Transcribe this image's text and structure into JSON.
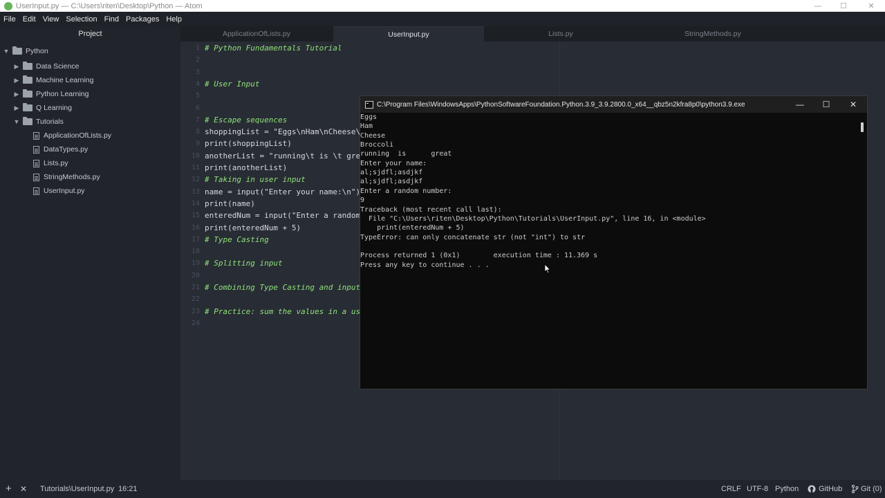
{
  "window": {
    "title": "UserInput.py — C:\\Users\\riten\\Desktop\\Python — Atom",
    "controls": [
      "—",
      "☐",
      "✕"
    ]
  },
  "menu": [
    "File",
    "Edit",
    "View",
    "Selection",
    "Find",
    "Packages",
    "Help"
  ],
  "sidebar": {
    "title": "Project",
    "root": "Python",
    "folders": [
      "Data Science",
      "Machine Learning",
      "Python Learning",
      "Q Learning",
      "Tutorials"
    ],
    "files": [
      "ApplicationOfLists.py",
      "DataTypes.py",
      "Lists.py",
      "StringMethods.py",
      "UserInput.py"
    ]
  },
  "tabs": [
    "ApplicationOfLists.py",
    "UserInput.py",
    "Lists.py",
    "StringMethods.py"
  ],
  "editor": {
    "line_numbers": [
      "1",
      "2",
      "3",
      "4",
      "5",
      "6",
      "7",
      "8",
      "9",
      "10",
      "11",
      "12",
      "13",
      "14",
      "15",
      "16",
      "17",
      "18",
      "19",
      "20",
      "21",
      "22",
      "23",
      "24"
    ],
    "lines": [
      "# Python Fundamentals Tutorial",
      "",
      "",
      "# User Input",
      "",
      "",
      "# Escape sequences",
      "shoppingList = \"Eggs\\nHam\\nCheese\\n",
      "print(shoppingList)",
      "anotherList = \"running\\t is \\t grea",
      "print(anotherList)",
      "# Taking in user input",
      "name = input(\"Enter your name:\\n\")",
      "print(name)",
      "enteredNum = input(\"Enter a random",
      "print(enteredNum + 5)",
      "# Type Casting",
      "",
      "# Splitting input",
      "",
      "# Combining Type Casting and input",
      "",
      "# Practice: sum the values in a use",
      ""
    ]
  },
  "console": {
    "title": "C:\\Program Files\\WindowsApps\\PythonSoftwareFoundation.Python.3.9_3.9.2800.0_x64__qbz5n2kfra8p0\\python3.9.exe",
    "controls": [
      "—",
      "☐",
      "✕"
    ],
    "lines": [
      "Eggs",
      "Ham",
      "Cheese",
      "Broccoli",
      "running  is      great",
      "Enter your name:",
      "al;sjdfl;asdjkf",
      "al;sjdfl;asdjkf",
      "Enter a random number:",
      "9",
      "Traceback (most recent call last):",
      "  File \"C:\\Users\\riten\\Desktop\\Python\\Tutorials\\UserInput.py\", line 16, in <module>",
      "    print(enteredNum + 5)",
      "TypeError: can only concatenate str (not \"int\") to str",
      "",
      "Process returned 1 (0x1)        execution time : 11.369 s",
      "Press any key to continue . . ."
    ]
  },
  "statusbar": {
    "add": "+",
    "close": "✕",
    "path": "Tutorials\\UserInput.py",
    "cursor": "16:21",
    "line_ending": "CRLF",
    "encoding": "UTF-8",
    "grammar": "Python",
    "github": "GitHub",
    "git": "Git (0)"
  }
}
